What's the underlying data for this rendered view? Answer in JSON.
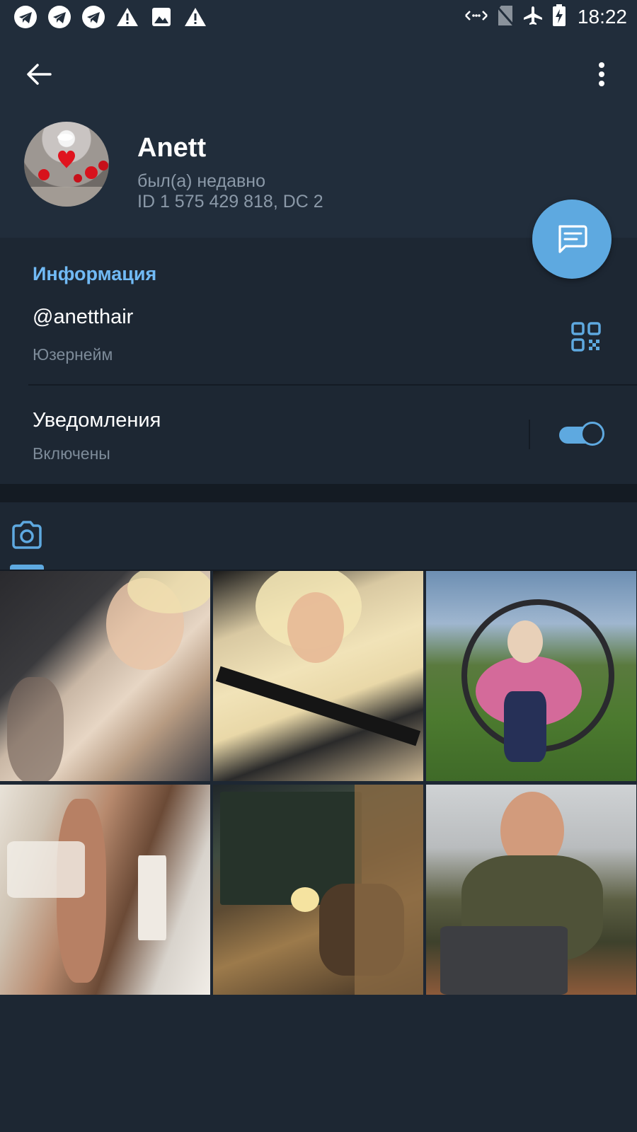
{
  "status_bar": {
    "left_icons": [
      "telegram-icon",
      "telegram-icon",
      "telegram-icon",
      "warning-icon",
      "image-icon",
      "warning-icon"
    ],
    "right_icons": [
      "data-arrows-icon",
      "no-sim-icon",
      "airplane-icon",
      "battery-charging-icon"
    ],
    "time": "18:22"
  },
  "header": {
    "name": "Anett",
    "last_seen": "был(а) недавно",
    "id_line": "ID 1 575 429 818, DC 2"
  },
  "info": {
    "section_title": "Информация",
    "username": "@anetthair",
    "username_label": "Юзернейм",
    "notifications": "Уведомления",
    "notifications_state": "Включены",
    "notifications_enabled": true
  },
  "media": {
    "active_tab": "photos",
    "photos": [
      {
        "subject": "selfie in car, beige top"
      },
      {
        "subject": "selfie in car, yellow t-shirt"
      },
      {
        "subject": "woman in pink round chair outdoors"
      },
      {
        "subject": "mirror selfie in bedroom"
      },
      {
        "subject": "man relaxing in log cabin"
      },
      {
        "subject": "man with laptop at table"
      }
    ]
  },
  "colors": {
    "accent": "#5ea9e0",
    "header_bg": "#212d3b",
    "page_bg": "#1d2733",
    "section_title": "#71baf5",
    "secondary_text": "#7d8b99"
  }
}
